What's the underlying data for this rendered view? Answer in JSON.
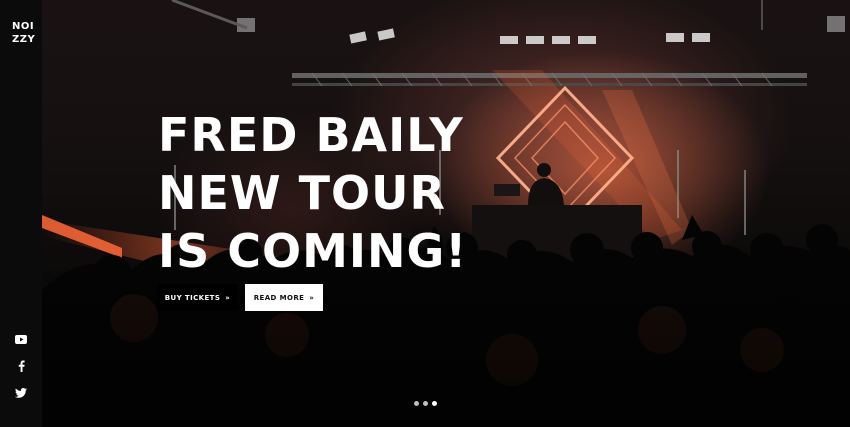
{
  "brand": {
    "logo_line1": "NOI",
    "logo_line2": "ZZY"
  },
  "hero": {
    "headline_line1": "FRED BAILY",
    "headline_line2": "NEW TOUR",
    "headline_line3": "IS COMING!"
  },
  "buttons": {
    "buy_tickets": "BUY TICKETS",
    "read_more": "READ MORE",
    "arrow": "»"
  },
  "social": [
    "youtube-icon",
    "facebook-icon",
    "twitter-icon"
  ],
  "slider": {
    "slides": 3,
    "active_index": 2
  },
  "colors": {
    "sidebar": "#0b0b0b",
    "accent_light": "#ff7a55",
    "button_dark": "#000000",
    "button_light": "#ffffff"
  }
}
